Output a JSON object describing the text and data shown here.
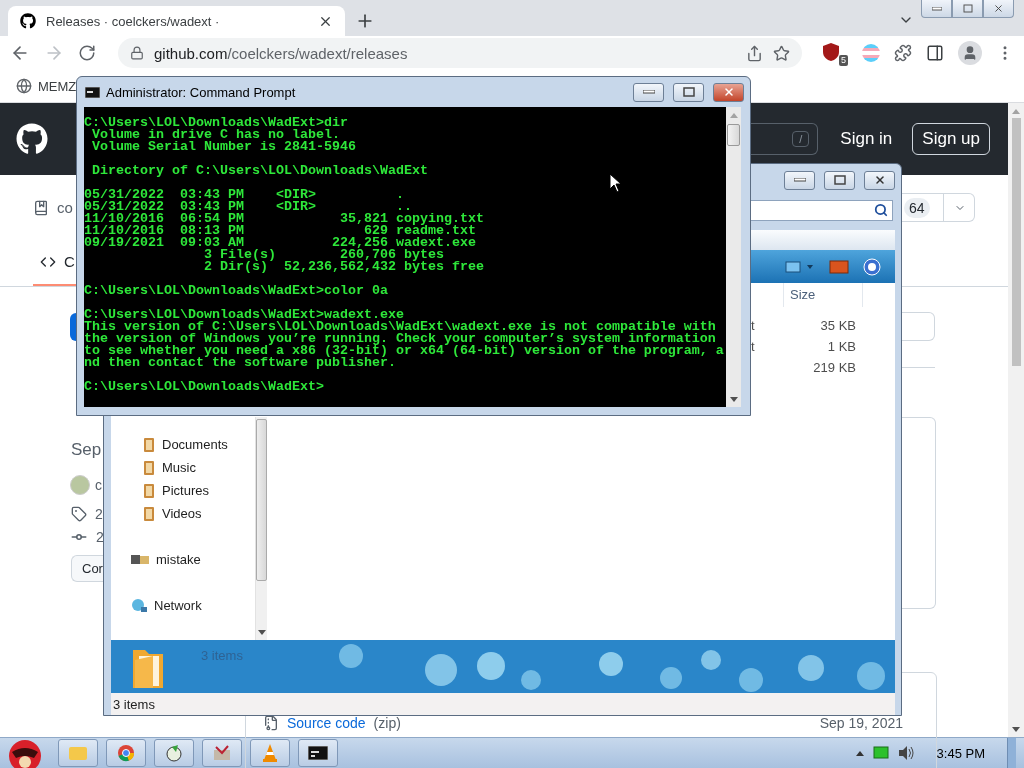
{
  "browser": {
    "tabs": [
      {
        "title": "Releases · coelckers/wadext ·",
        "selected": true
      }
    ],
    "address": {
      "host": "github.com",
      "path": "/coelckers/wadext/releases"
    },
    "extension_badge": "5",
    "bookmarks": [
      {
        "label": "MEMZ"
      }
    ]
  },
  "github": {
    "search_key": "/",
    "sign_in": "Sign in",
    "sign_up": "Sign up",
    "repo_fragment": "co",
    "tab_fragment": "C",
    "counter": "64",
    "date_fragment": "Sep",
    "author_fragment": "c",
    "tag_fragment": "2",
    "commit_fragment": "2",
    "button_fragment": "Cor",
    "asset": {
      "name": "Source code",
      "type": "(zip)",
      "date": "Sep 19, 2021"
    }
  },
  "explorer": {
    "columns": [
      "Size"
    ],
    "rows": [
      {
        "name_fragment": "t",
        "size": "35 KB"
      },
      {
        "name_fragment": "t",
        "size": "1 KB"
      },
      {
        "size": "219 KB"
      }
    ],
    "nav": [
      {
        "label": "Documents",
        "kind": "library"
      },
      {
        "label": "Music",
        "kind": "library"
      },
      {
        "label": "Pictures",
        "kind": "library"
      },
      {
        "label": "Videos",
        "kind": "library"
      },
      {
        "label": "mistake",
        "kind": "computer"
      },
      {
        "label": "Network",
        "kind": "network"
      }
    ],
    "details_text": "3 items",
    "status": "3 items"
  },
  "console": {
    "title": "Administrator: Command Prompt",
    "blocks": [
      [
        "C:\\Users\\LOL\\Downloads\\WadExt>dir",
        " Volume in drive C has no label.",
        " Volume Serial Number is 2841-5946"
      ],
      [
        " Directory of C:\\Users\\LOL\\Downloads\\WadExt"
      ],
      [
        "05/31/2022  03:43 PM    <DIR>          .",
        "05/31/2022  03:43 PM    <DIR>          ..",
        "11/10/2016  06:54 PM            35,821 copying.txt",
        "11/10/2016  08:13 PM               629 readme.txt",
        "09/19/2021  09:03 AM           224,256 wadext.exe",
        "               3 File(s)        260,706 bytes",
        "               2 Dir(s)  52,236,562,432 bytes free"
      ],
      [
        "C:\\Users\\LOL\\Downloads\\WadExt>color 0a"
      ],
      [
        "C:\\Users\\LOL\\Downloads\\WadExt>wadext.exe",
        "This version of C:\\Users\\LOL\\Downloads\\WadExt\\wadext.exe is not compatible with",
        "the version of Windows you’re running. Check your computer’s system information",
        "to see whether you need a x86 (32-bit) or x64 (64-bit) version of the program, a",
        "nd then contact the software publisher."
      ],
      [
        "C:\\Users\\LOL\\Downloads\\WadExt>"
      ]
    ]
  },
  "taskbar": {
    "clock": "3:45 PM"
  }
}
